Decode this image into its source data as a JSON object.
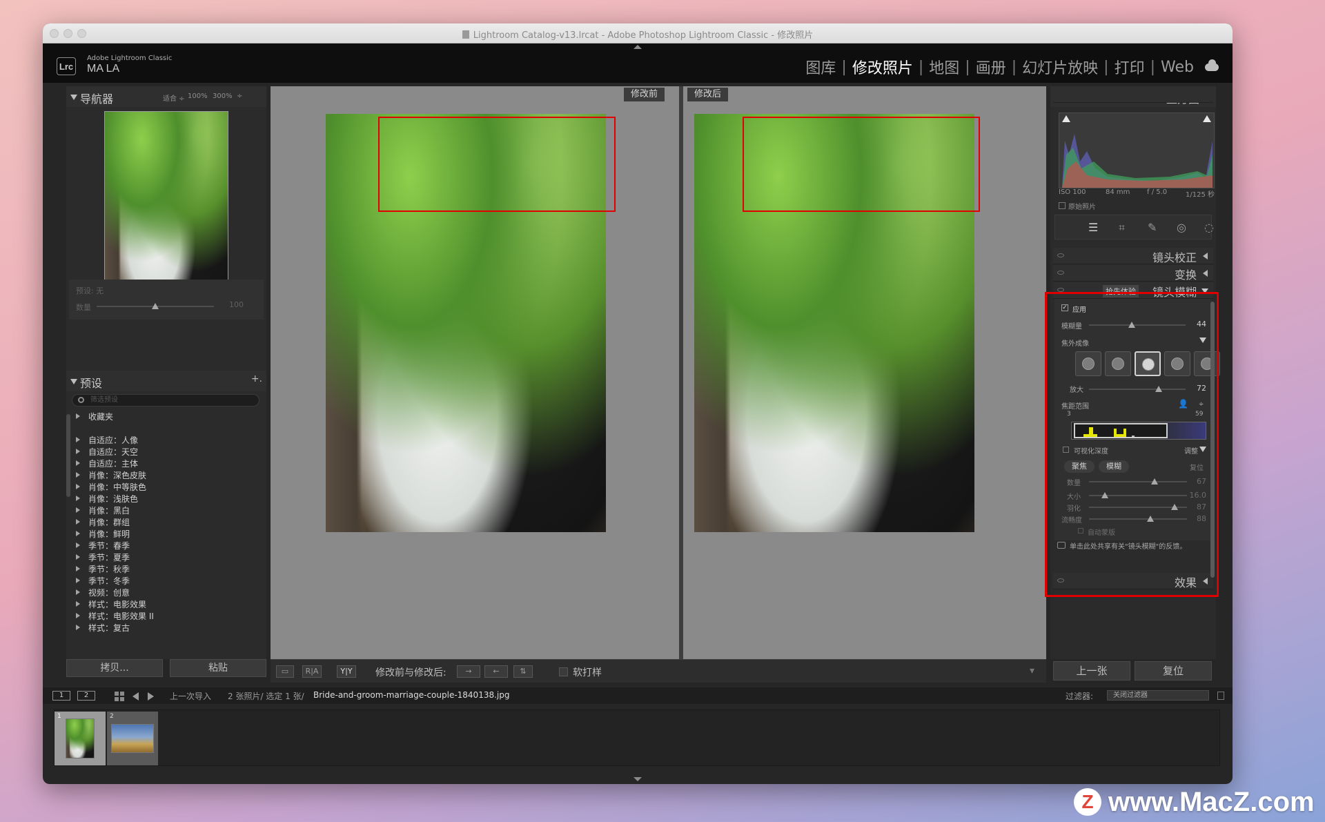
{
  "window": {
    "title": "Lightroom Catalog-v13.lrcat - Adobe Photoshop Lightroom Classic - 修改照片"
  },
  "identity": {
    "app": "Adobe Lightroom Classic",
    "user": "MA LA",
    "badge": "Lrc"
  },
  "modules": [
    {
      "label": "图库",
      "active": false
    },
    {
      "label": "修改照片",
      "active": true
    },
    {
      "label": "地图",
      "active": false
    },
    {
      "label": "画册",
      "active": false
    },
    {
      "label": "幻灯片放映",
      "active": false
    },
    {
      "label": "打印",
      "active": false
    },
    {
      "label": "Web",
      "active": false
    }
  ],
  "module_separator": "|",
  "navigator": {
    "title": "导航器",
    "zoom": [
      "适合 ÷",
      "100%",
      "300%"
    ]
  },
  "preset_box": {
    "preset_label": "预设: 无",
    "amount_label": "数量",
    "amount_value": "100"
  },
  "presets": {
    "title": "预设",
    "add": "+.",
    "search_placeholder": "筛选预设",
    "items": [
      "收藏夹",
      "自适应：人像",
      "自适应：天空",
      "自适应：主体",
      "肖像：深色皮肤",
      "肖像：中等肤色",
      "肖像：浅肤色",
      "肖像：黑白",
      "肖像：群组",
      "肖像：鲜明",
      "季节：春季",
      "季节：夏季",
      "季节：秋季",
      "季节：冬季",
      "视频：创意",
      "样式：电影效果",
      "样式：电影效果 II",
      "样式：复古"
    ]
  },
  "left_buttons": {
    "copy": "拷贝...",
    "paste": "粘贴"
  },
  "view": {
    "before": "修改前",
    "after": "修改后"
  },
  "toolbar": {
    "loupe": "▭",
    "ra": "R|A",
    "yy": "Y|Y",
    "compare_label": "修改前与修改后:",
    "softproof": "软打样"
  },
  "histogram": {
    "title": "直方图",
    "iso": "ISO 100",
    "focal": "84 mm",
    "aperture": "f / 5.0",
    "shutter": "1/125 秒",
    "original": "原始照片"
  },
  "sections": {
    "lens": "镜头校正",
    "transform": "变换",
    "lensblur": "镜头模糊",
    "early": "抢先体验",
    "effects": "效果"
  },
  "lens_blur": {
    "apply": "应用",
    "amount_label": "模糊量",
    "amount_value": "44",
    "bokeh_label": "焦外成像",
    "boost_label": "放大",
    "boost_value": "72",
    "focal_label": "焦距范围",
    "range_min": "3",
    "range_max": "59",
    "depth_label": "可视化深度",
    "adjust_label": "调整",
    "focus_btn": "聚焦",
    "blur_btn": "模糊",
    "reset": "复位",
    "sub_amount": "数量",
    "sub_amount_val": "67",
    "size": "大小",
    "size_val": "16.0",
    "feather": "羽化",
    "feather_val": "87",
    "flow": "流畅度",
    "flow_val": "88",
    "automask": "自动蒙版",
    "feedback": "单击此处共享有关\"镜头模糊\"的反馈。"
  },
  "values": {
    "lb_amount": 0.44,
    "lb_boost": 0.72,
    "sub_amount": 0.67,
    "sub_size": 0.16,
    "sub_feather": 0.87,
    "sub_flow": 0.63,
    "preset_amount": 0.5
  },
  "right_buttons": {
    "prev": "上一张",
    "reset": "复位"
  },
  "filmbar": {
    "page1": "1",
    "page2": "2",
    "source": "上一次导入",
    "count": "2 张照片/ 选定 1 张/",
    "filename": "Bride-and-groom-marriage-couple-1840138.jpg",
    "filter_label": "过滤器:",
    "filter_value": "关闭过滤器"
  },
  "filmstrip": [
    {
      "index": "1"
    },
    {
      "index": "2"
    }
  ],
  "watermark": {
    "letter": "Z",
    "text": "www.MacZ.com"
  },
  "colors": {
    "highlight": "#e00000",
    "active_module": "#ffffff",
    "panel": "#2b2b2b"
  }
}
